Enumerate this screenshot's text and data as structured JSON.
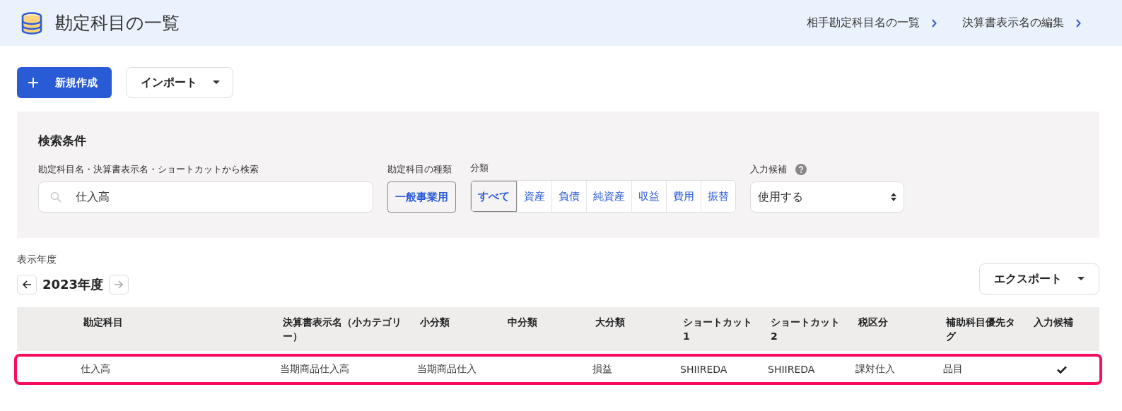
{
  "header": {
    "title": "勘定科目の一覧",
    "links": [
      "相手勘定科目名の一覧",
      "決算書表示名の編集"
    ]
  },
  "actions": {
    "create": "新規作成",
    "import": "インポート"
  },
  "search": {
    "heading": "検索条件",
    "keyword_label": "勘定科目名・決算書表示名・ショートカットから検索",
    "keyword_value": "仕入高",
    "type_label": "勘定科目の種類",
    "type_value": "一般事業用",
    "category_label": "分類",
    "categories": [
      {
        "label": "すべて",
        "selected": true
      },
      {
        "label": "資産",
        "selected": false
      },
      {
        "label": "負債",
        "selected": false
      },
      {
        "label": "純資産",
        "selected": false
      },
      {
        "label": "収益",
        "selected": false
      },
      {
        "label": "費用",
        "selected": false
      },
      {
        "label": "振替",
        "selected": false
      }
    ],
    "suggest_label": "入力候補",
    "suggest_value": "使用する"
  },
  "year": {
    "label": "表示年度",
    "value": "2023年度",
    "prev_disabled": false,
    "next_disabled": true
  },
  "export": "エクスポート",
  "table": {
    "columns": [
      "勘定科目",
      "決算書表示名（小カテゴリー）",
      "小分類",
      "中分類",
      "大分類",
      "ショートカット1",
      "ショートカット2",
      "税区分",
      "補助科目優先タグ",
      "入力候補"
    ],
    "rows": [
      {
        "highlighted": true,
        "cells": [
          "仕入高",
          "当期商品仕入高",
          "当期商品仕入",
          "",
          "損益",
          "SHIIREDA",
          "SHIIREDA",
          "課対仕入",
          "品目"
        ],
        "suggest": true
      }
    ]
  }
}
